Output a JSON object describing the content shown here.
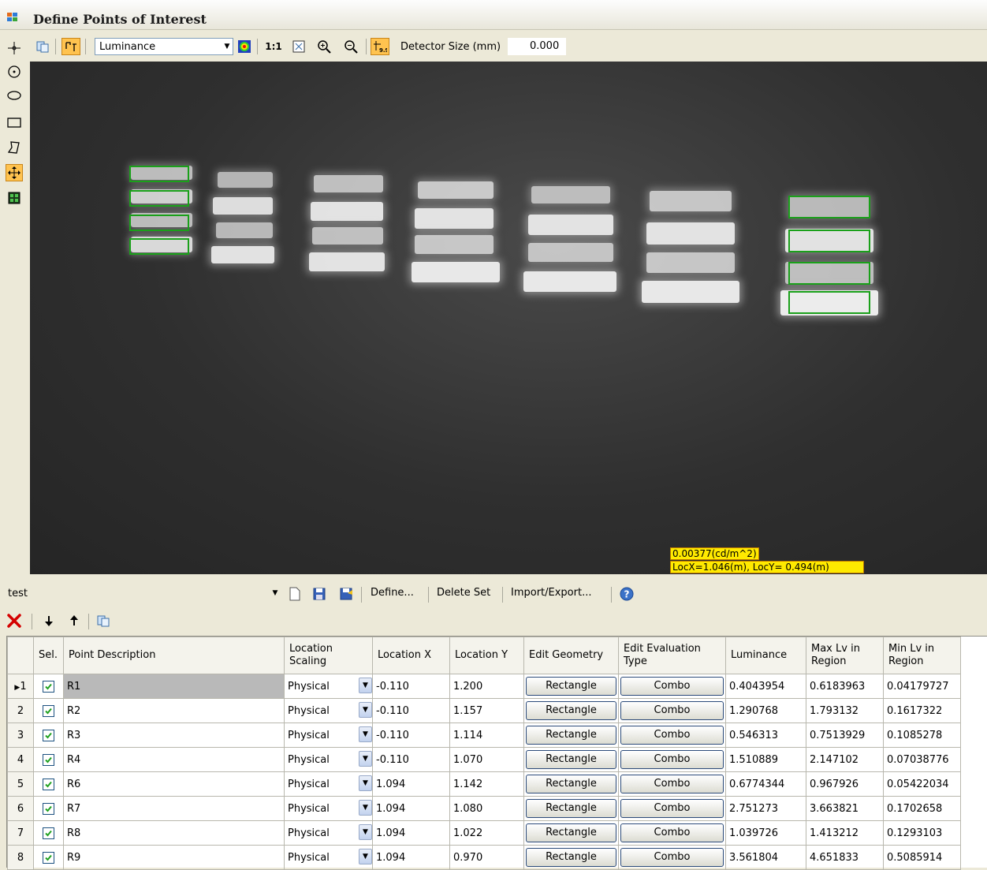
{
  "window": {
    "title": "Define Points of Interest"
  },
  "toolbar": {
    "display_mode": "Luminance",
    "scale_label": "1:1",
    "detector_size_label": "Detector Size (mm)",
    "detector_size_value": "0.000"
  },
  "viewer": {
    "readout_value": "0.00377(cd/m^2)",
    "readout_location": "LocX=1.046(m), LocY= 0.494(m)"
  },
  "set_bar": {
    "set_name": "test",
    "define_label": "Define...",
    "delete_set_label": "Delete Set",
    "import_export_label": "Import/Export..."
  },
  "table": {
    "columns": {
      "sel": "Sel.",
      "point_description": "Point Description",
      "location_scaling": [
        "Location",
        "Scaling"
      ],
      "location_x": "Location X",
      "location_y": "Location Y",
      "edit_geometry": "Edit Geometry",
      "edit_evaluation_type": [
        "Edit Evaluation",
        "Type"
      ],
      "luminance": "Luminance",
      "max_lv": [
        "Max Lv in",
        "Region"
      ],
      "min_lv": [
        "Min Lv in",
        "Region"
      ]
    },
    "rows": [
      {
        "num": "1",
        "desc": "R1",
        "scaling": "Physical",
        "x": "-0.110",
        "y": "1.200",
        "geometry": "Rectangle",
        "eval": "Combo",
        "lum": "0.4043954",
        "max": "0.6183963",
        "min": "0.04179727"
      },
      {
        "num": "2",
        "desc": "R2",
        "scaling": "Physical",
        "x": "-0.110",
        "y": "1.157",
        "geometry": "Rectangle",
        "eval": "Combo",
        "lum": "1.290768",
        "max": "1.793132",
        "min": "0.1617322"
      },
      {
        "num": "3",
        "desc": "R3",
        "scaling": "Physical",
        "x": "-0.110",
        "y": "1.114",
        "geometry": "Rectangle",
        "eval": "Combo",
        "lum": "0.546313",
        "max": "0.7513929",
        "min": "0.1085278"
      },
      {
        "num": "4",
        "desc": "R4",
        "scaling": "Physical",
        "x": "-0.110",
        "y": "1.070",
        "geometry": "Rectangle",
        "eval": "Combo",
        "lum": "1.510889",
        "max": "2.147102",
        "min": "0.07038776"
      },
      {
        "num": "5",
        "desc": "R6",
        "scaling": "Physical",
        "x": "1.094",
        "y": "1.142",
        "geometry": "Rectangle",
        "eval": "Combo",
        "lum": "0.6774344",
        "max": "0.967926",
        "min": "0.05422034"
      },
      {
        "num": "6",
        "desc": "R7",
        "scaling": "Physical",
        "x": "1.094",
        "y": "1.080",
        "geometry": "Rectangle",
        "eval": "Combo",
        "lum": "2.751273",
        "max": "3.663821",
        "min": "0.1702658"
      },
      {
        "num": "7",
        "desc": "R8",
        "scaling": "Physical",
        "x": "1.094",
        "y": "1.022",
        "geometry": "Rectangle",
        "eval": "Combo",
        "lum": "1.039726",
        "max": "1.413212",
        "min": "0.1293103"
      },
      {
        "num": "8",
        "desc": "R9",
        "scaling": "Physical",
        "x": "1.094",
        "y": "0.970",
        "geometry": "Rectangle",
        "eval": "Combo",
        "lum": "3.561804",
        "max": "4.651833",
        "min": "0.5085914"
      }
    ]
  },
  "colors": {
    "toolbar_bg": "#ece9d8",
    "active_tool": "#ffc34f",
    "roi_outline": "#1aa01a",
    "readout_bg": "#ffea00",
    "delete_icon": "#d40000"
  },
  "icons": {
    "left_tools": [
      "crosshair-icon",
      "circle-point-icon",
      "ellipse-icon",
      "rectangle-icon",
      "polygon-icon",
      "move-icon",
      "grid-icon"
    ],
    "toolbar": [
      "copy-icon",
      "roi-overlay-icon",
      "false-color-icon",
      "fit-to-window-icon",
      "zoom-in-icon",
      "zoom-out-icon",
      "detector-size-icon"
    ],
    "set_bar": [
      "new-icon",
      "save-icon",
      "save-as-icon",
      "help-icon"
    ],
    "row_tools": [
      "delete-row-icon",
      "move-down-icon",
      "move-up-icon",
      "copy-row-icon"
    ]
  }
}
